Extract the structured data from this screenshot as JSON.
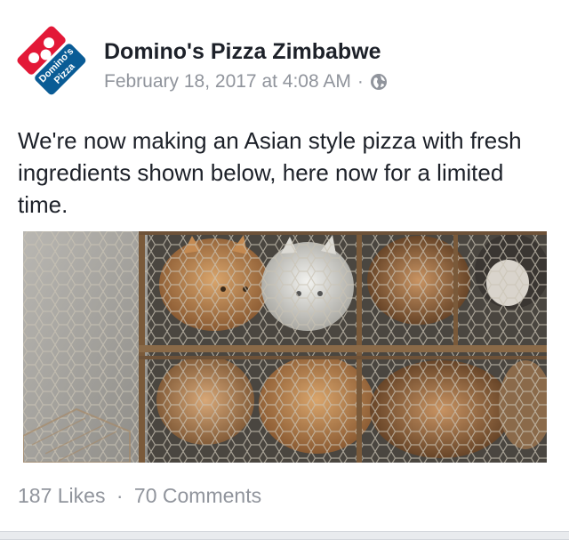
{
  "post": {
    "page_name": "Domino's Pizza Zimbabwe",
    "timestamp": "February 18, 2017 at 4:08 AM",
    "separator": "·",
    "privacy_icon": "globe-icon",
    "text": "We're now making an Asian style pizza with fresh ingredients shown below, here now for a limited time.",
    "logo": {
      "icon": "dominos-logo",
      "lettering": "Domino's Pizza",
      "colors": {
        "blue": "#0a5c96",
        "red": "#e31837"
      }
    },
    "photo": {
      "icon": "caged-cats-photo"
    },
    "stats": {
      "likes": "187 Likes",
      "dot": "·",
      "comments": "70 Comments"
    }
  }
}
